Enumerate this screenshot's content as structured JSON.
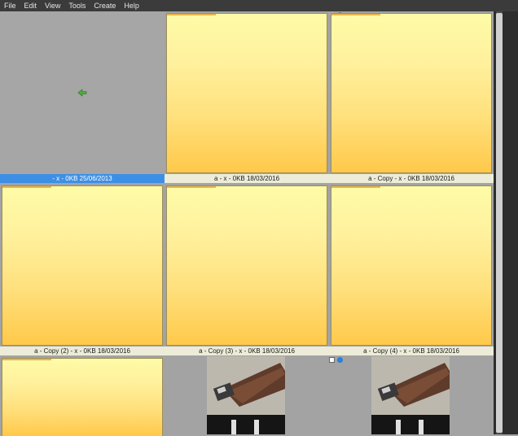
{
  "menu": [
    "File",
    "Edit",
    "View",
    "Tools",
    "Create",
    "Help"
  ],
  "rows": [
    [
      {
        "caption": "- x - 0KB 25/06/2013",
        "kind": "folder",
        "selected": true
      },
      {
        "caption": "a - x - 0KB 18/03/2016",
        "kind": "file"
      },
      {
        "caption": "a - Copy - x - 0KB 18/03/2016",
        "kind": "file"
      }
    ],
    [
      {
        "caption": "a - Copy (2) - x - 0KB 18/03/2016",
        "kind": "file"
      },
      {
        "caption": "a - Copy (3) - x - 0KB 18/03/2016",
        "kind": "file"
      },
      {
        "caption": "a - Copy (4) - x - 0KB 18/03/2016",
        "kind": "file"
      }
    ]
  ],
  "icons": {
    "star": "☆",
    "green_dot_color": "#6ab82a",
    "blue_dot_color": "#2a7fe0"
  }
}
